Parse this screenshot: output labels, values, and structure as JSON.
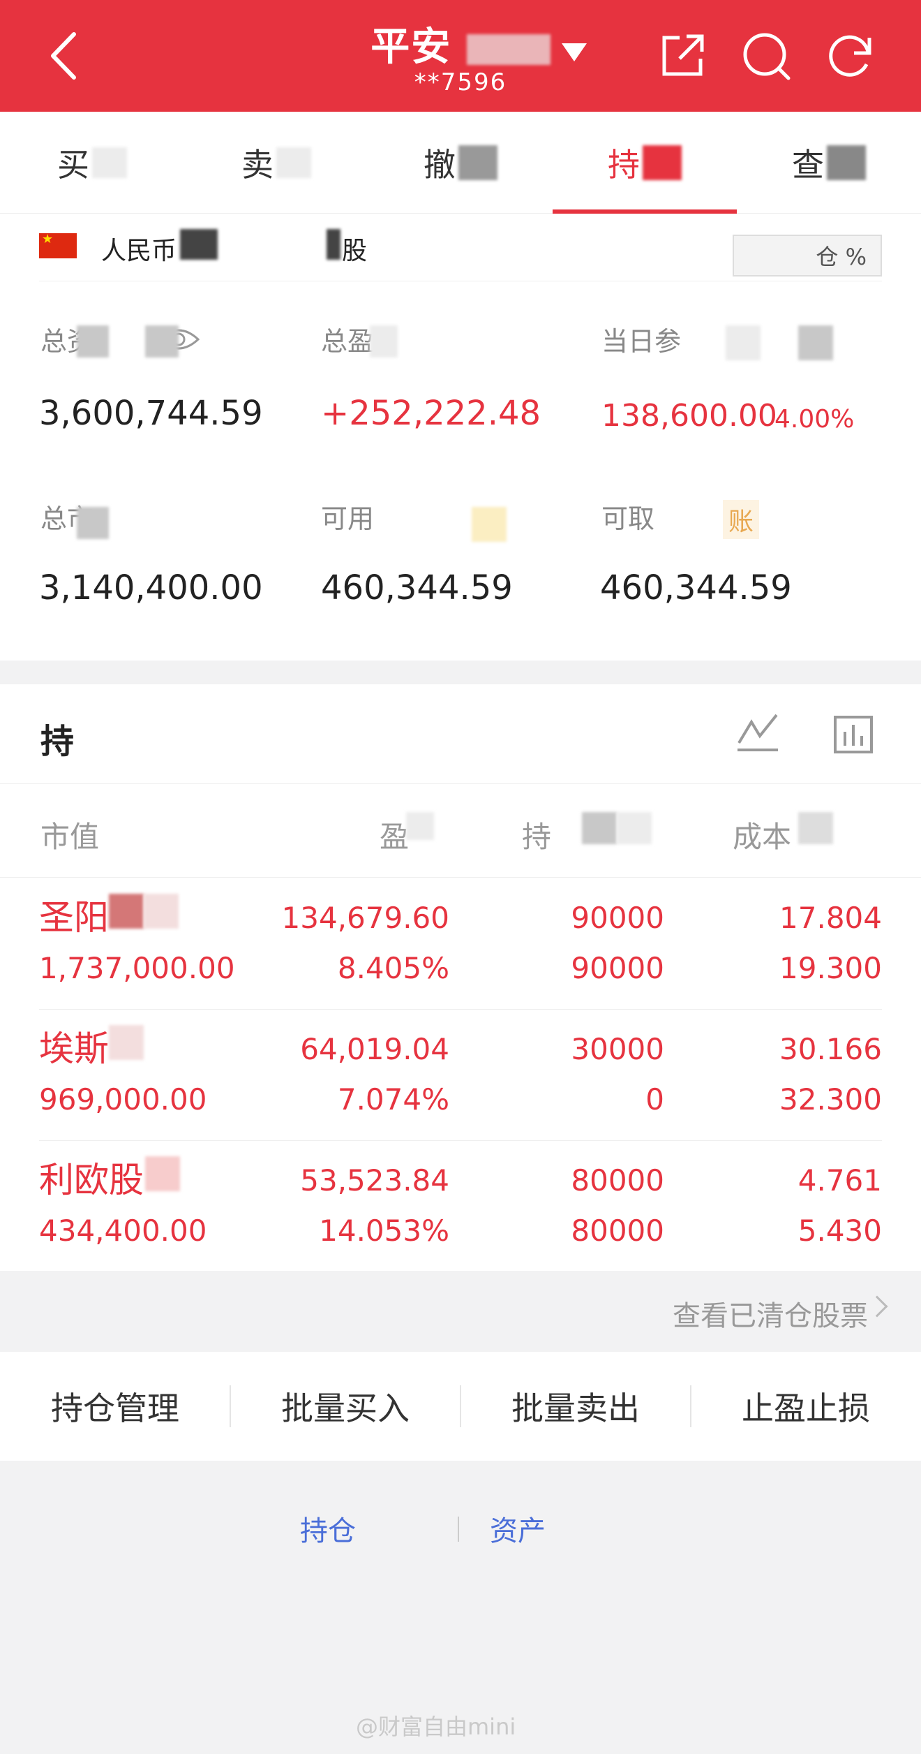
{
  "header": {
    "title": "平安",
    "account": "**7596",
    "bg_color": "#e6333f"
  },
  "tabs": [
    {
      "label": "买"
    },
    {
      "label": "卖"
    },
    {
      "label": "撤"
    },
    {
      "label": "持"
    },
    {
      "label": "查"
    }
  ],
  "summary": {
    "currency": "人民币",
    "currency_market": "股",
    "position_pill": "仓 %",
    "total_assets": {
      "label": "总资",
      "value": "3,600,744.59"
    },
    "total_pnl": {
      "label": "总盈",
      "value": "+252,222.48"
    },
    "daily_pnl": {
      "label": "当日参",
      "value": "138,600.00",
      "pct": "4.00%"
    },
    "total_market": {
      "label": "总市",
      "value": "3,140,400.00"
    },
    "available": {
      "label": "可用",
      "value": "460,344.59"
    },
    "withdrawable": {
      "label": "可取",
      "value": "460,344.59",
      "badge": "账"
    }
  },
  "holdings": {
    "title": "持",
    "headers": {
      "col1": "市值",
      "col2": "盈",
      "col3": "持",
      "col4": "成本"
    },
    "rows": [
      {
        "name": "圣阳",
        "market_value": "1,737,000.00",
        "pnl": "134,679.60",
        "pnl_pct": "8.405%",
        "qty": "90000",
        "avail": "90000",
        "cost": "17.804",
        "price": "19.300"
      },
      {
        "name": "埃斯",
        "market_value": "969,000.00",
        "pnl": "64,019.04",
        "pnl_pct": "7.074%",
        "qty": "30000",
        "avail": "0",
        "cost": "30.166",
        "price": "32.300"
      },
      {
        "name": "利欧股",
        "market_value": "434,400.00",
        "pnl": "53,523.84",
        "pnl_pct": "14.053%",
        "qty": "80000",
        "avail": "80000",
        "cost": "4.761",
        "price": "5.430"
      }
    ],
    "cleared_link": "查看已清仓股票"
  },
  "actions": [
    "持仓管理",
    "批量买入",
    "批量卖出",
    "止盈止损"
  ],
  "footer_links": [
    "持仓",
    "资产"
  ],
  "watermark": "@财富自由mini"
}
